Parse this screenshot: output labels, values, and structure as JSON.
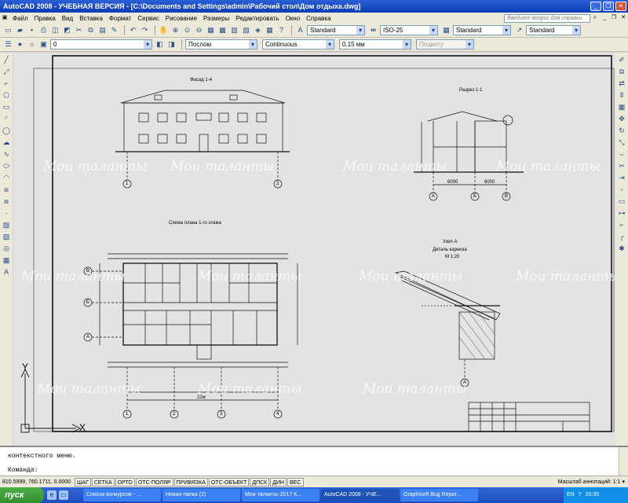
{
  "window": {
    "title": "AutoCAD 2008 - УЧЕБНАЯ ВЕРСИЯ - [C:\\Documents and Settings\\admin\\Рабочий стол\\Дом отдыха.dwg]",
    "minimize": "_",
    "restore": "❐",
    "close": "✕"
  },
  "menu": {
    "items": [
      "Файл",
      "Правка",
      "Вид",
      "Вставка",
      "Формат",
      "Сервис",
      "Рисование",
      "Размеры",
      "Редактировать",
      "Окно",
      "Справка"
    ],
    "help_placeholder": "Введите вопрос для справки"
  },
  "toolbar_styles": {
    "text_style": "Standard",
    "dim_style": "ISO-25",
    "table_style": "Standard",
    "multileader_style": "Standard"
  },
  "toolbar_layers": {
    "layer": "0",
    "color": "Послою",
    "linetype": "Continuous",
    "lineweight": "0.15 мм",
    "plotstyle": "Поцвету"
  },
  "drawing": {
    "watermark": "Мои таланты",
    "facade_title": "Фасад 1-4",
    "section_title": "Разрез 1-1",
    "plan_title": "Схема плана 1-го этажа",
    "node_title": "Узел А",
    "node_subtitle": "Деталь карниза",
    "node_scale": "М 1:20",
    "axes_num": [
      "1",
      "2",
      "3",
      "4"
    ],
    "axes_letter": [
      "А",
      "Б",
      "В"
    ],
    "section_dims": [
      "6000",
      "6000"
    ],
    "plan_dims_total": "22м",
    "ucs_x": "X",
    "ucs_y": "Y"
  },
  "command": {
    "line1": "контекстного меню.",
    "line2": "Команда:"
  },
  "status": {
    "coords": "810.5999, 760.1711, 0.0000",
    "buttons": [
      "ШАГ",
      "СЕТКА",
      "ОРТО",
      "ОТС-ПОЛЯР",
      "ПРИВЯЗКА",
      "ОТС-ОБЪЕКТ",
      "ДПСК",
      "ДИН",
      "ВЕС"
    ],
    "annotation_scale_label": "Масштаб аннотаций:",
    "annotation_scale": "1:1"
  },
  "taskbar": {
    "start": "пуск",
    "tasks": [
      "Список конкурсов - ...",
      "Новая папка (2)",
      "Мои таланты 2017 К...",
      "AutoCAD 2008 - УЧЕ...",
      "Graphisoft Bug Repor..."
    ],
    "active_task": 3,
    "lang": "EN",
    "clock": "20:35"
  }
}
